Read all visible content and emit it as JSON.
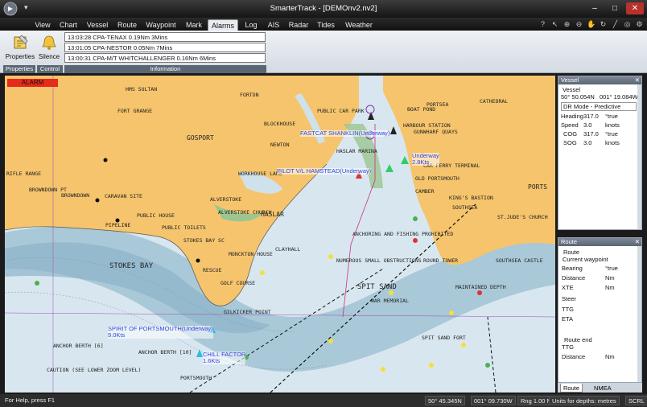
{
  "window": {
    "title": "SmarterTrack - [DEMOnv2.nv2]"
  },
  "ribbon_tabs": [
    "View",
    "Chart",
    "Vessel",
    "Route",
    "Waypoint",
    "Mark",
    "Alarms",
    "Log",
    "AIS",
    "Radar",
    "Tides",
    "Weather"
  ],
  "active_tab": "Alarms",
  "ribbon": {
    "properties_label": "Properties",
    "silence_label": "Silence",
    "group_properties": "Properties",
    "group_control": "Control",
    "group_information": "Information",
    "alarms": [
      "13:03:28 CPA-TENAX 0.19Nm 3Mins",
      "13:01:05 CPA-NESTOR 0.05Nm 7Mins",
      "13:00:31 CPA-M/T WHITCHALLENGER 0.16Nm 6Mins"
    ]
  },
  "chart": {
    "alarm_label": "ALARM",
    "place_labels": [
      "GOSPORT",
      "HASLAR",
      "STOKES BAY",
      "SPIT SAND",
      "PORTS",
      "HMS SULTAN",
      "FORT GRANGE",
      "FORTON",
      "BLOCKHOUSE",
      "NEWTON",
      "WORKHOUSE LAKE",
      "ALVERSTOKE",
      "ALVERSTOKE CHURCH",
      "CLAYHALL",
      "MONCKTON HOUSE",
      "STOKES BAY SC",
      "PUBLIC HOUSE",
      "PUBLIC TOILETS",
      "CARAVAN SITE",
      "PIPELINE",
      "BROWNDOWN",
      "BROWNDOWN PT",
      "RIFLE RANGE",
      "GOLF COURSE",
      "RESCUE",
      "GILKICKER POINT",
      "ANCHOR BERTH [10]",
      "ANCHOR BERTH [6]",
      "PORTSMOUTH",
      "HARBOUR STATION",
      "PORTSEA",
      "CATHEDRAL",
      "SOUTHSEA",
      "ST.JUDE'S CHURCH",
      "KING'S BASTION",
      "SOUTHSEA CASTLE",
      "SPIT SAND FORT",
      "NUMEROUS SMALL OBSTRUCTIONS",
      "ANCHORING AND FISHING PROHIBITED",
      "MAINTAINED DEPTH",
      "WAR MEMORIAL",
      "OLD PORTSMOUTH",
      "CAR FERRY TERMINAL",
      "BOAT POND",
      "PUBLIC CAR PARK",
      "HASLAR MARINA",
      "GUNWHARF QUAYS",
      "CAMBER",
      "ROUND TOWER",
      "CAUTION (SEE LOWER ZOOM LEVEL)"
    ],
    "vessels": [
      {
        "name": "FASTCAT SHANKLIN(Underway)",
        "speed": ""
      },
      {
        "name": "PILOT V/L HAMSTEAD(Underway)",
        "speed": ""
      },
      {
        "name": "Underway",
        "speed": "2.8Kts"
      },
      {
        "name": "SPIRIT OF PORTSMOUTH(Underway)",
        "speed": "9.0Kts"
      },
      {
        "name": "CHILL FACTOR",
        "speed": "1.6Kts"
      }
    ]
  },
  "vessel_panel": {
    "header": "Vessel",
    "section": "Vessel",
    "lat": "50° 50.054N",
    "lon": "001° 19.084W",
    "mode": "DR Mode - Predictive",
    "rows": [
      {
        "label": "Heading",
        "value": "317.0",
        "unit": "°true"
      },
      {
        "label": "Speed",
        "value": "3.0",
        "unit": "knots"
      },
      {
        "label": "COG",
        "value": "317.0",
        "unit": "°true"
      },
      {
        "label": "SOG",
        "value": "3.0",
        "unit": "knots"
      }
    ]
  },
  "route_panel": {
    "header": "Route",
    "section": "Route",
    "sub": "Current waypoint",
    "rows": [
      {
        "label": "Bearing",
        "unit": "°true"
      },
      {
        "label": "Distance",
        "unit": "Nm"
      },
      {
        "label": "XTE",
        "unit": "Nm"
      },
      {
        "label": "Steer",
        "unit": ""
      },
      {
        "label": "TTG",
        "unit": ""
      },
      {
        "label": "ETA",
        "unit": ""
      }
    ],
    "end_section": "Route end",
    "end_rows": [
      {
        "label": "TTG",
        "unit": ""
      },
      {
        "label": "Distance",
        "unit": "Nm"
      }
    ]
  },
  "bottom_tabs": [
    "Route",
    "NMEA"
  ],
  "statusbar": {
    "help": "For Help, press F1",
    "lat": "50° 45.345N",
    "lon": "001° 09.730W",
    "range": "Rng 1.00 Nm",
    "units": "Units for depths: metres",
    "scrl": "SCRL"
  },
  "colors": {
    "land": "#f5c46c",
    "sea": "#d8e7ef",
    "shallow": "#8fb4c9",
    "ribbon_bg": "#e3e8ee",
    "alarm": "#e62a1c",
    "vessel_label": "#3344dd"
  }
}
